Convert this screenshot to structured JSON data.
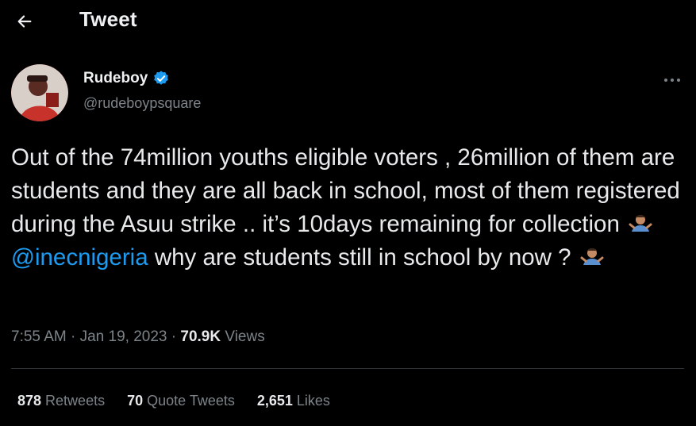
{
  "header": {
    "title": "Tweet"
  },
  "tweet": {
    "author": {
      "display_name": "Rudeboy",
      "handle": "@rudeboypsquare",
      "verified": true
    },
    "text": {
      "part1": "Out of the 74million youths eligible voters , 26million of them are students and they are all back in school, most of them registered during the Asuu strike .. it’s 10days remaining for collection",
      "mention": "@inecnigeria",
      "part2": "why are students still in school by now ?"
    },
    "meta": {
      "time": "7:55 AM",
      "separator": "·",
      "date": "Jan 19, 2023",
      "views_count": "70.9K",
      "views_label": "Views"
    },
    "stats": {
      "retweets": {
        "count": "878",
        "label": "Retweets"
      },
      "quote_tweets": {
        "count": "70",
        "label": "Quote Tweets"
      },
      "likes": {
        "count": "2,651",
        "label": "Likes"
      }
    }
  },
  "icons": {
    "back": "arrow-left-icon",
    "verified": "verified-badge-icon",
    "more": "more-horizontal-icon",
    "emoji": "person-shrugging-emoji"
  },
  "colors": {
    "background": "#000000",
    "text": "#e7e9ea",
    "secondary": "#7d8489",
    "accent": "#1d9bf0"
  }
}
